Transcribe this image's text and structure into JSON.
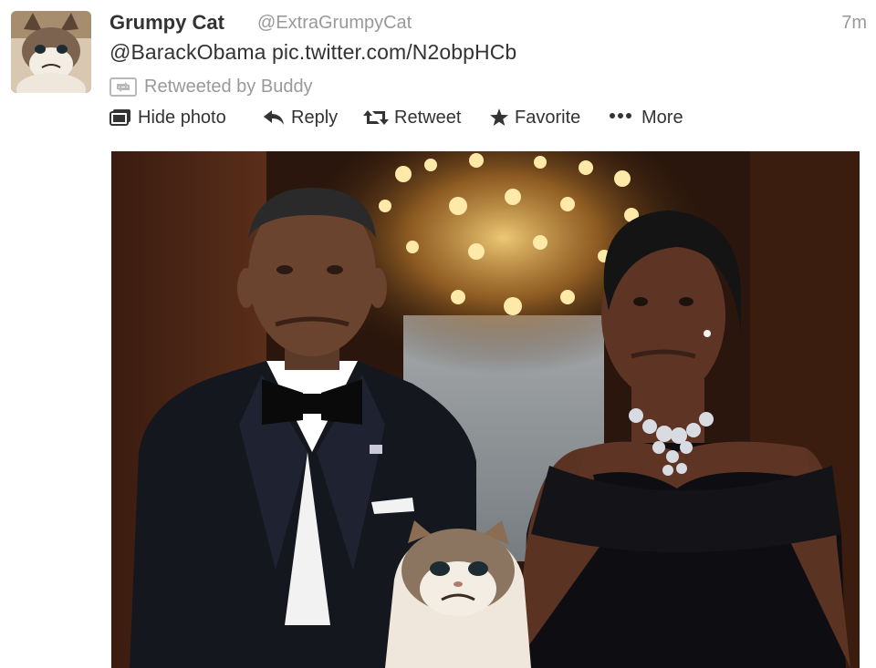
{
  "tweet": {
    "fullname": "Grumpy Cat",
    "username": "@ExtraGrumpyCat",
    "timestamp": "7m",
    "text": "@BarackObama pic.twitter.com/N2obpHCb",
    "retweeted_by": "Retweeted by Buddy"
  },
  "actions": {
    "hide_photo": "Hide photo",
    "reply": "Reply",
    "retweet": "Retweet",
    "favorite": "Favorite",
    "more": "More"
  },
  "icons": {
    "avatar": "grumpy-cat-avatar",
    "retweeted": "retweet-badge-icon",
    "hide_photo": "photo-icon",
    "reply": "reply-arrow-icon",
    "retweet": "retweet-icon",
    "favorite": "star-icon",
    "more": "ellipsis-icon"
  },
  "colors": {
    "text": "#333333",
    "muted": "#999999"
  }
}
